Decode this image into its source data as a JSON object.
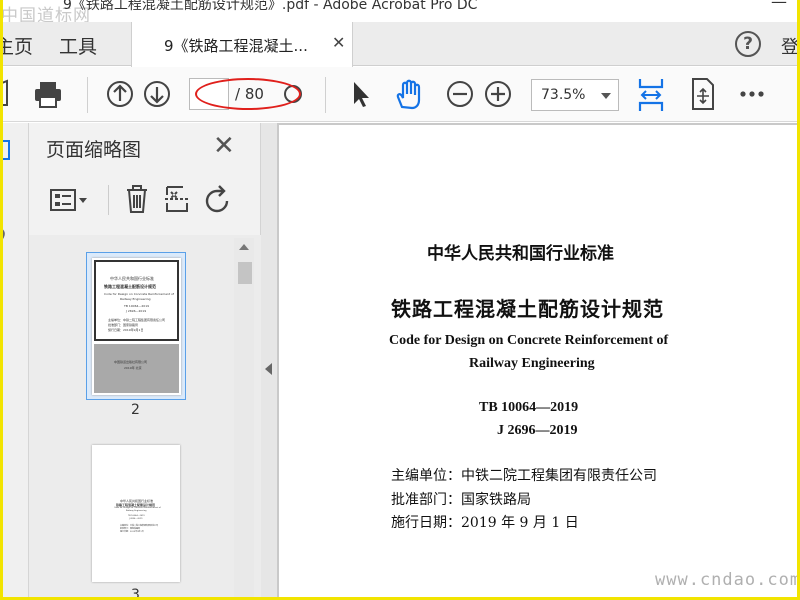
{
  "watermark_top": "中国道标网",
  "title_bar": {
    "title": "9《铁路工程混凝土配筋设计规范》.pdf - Adobe Acrobat Pro DC"
  },
  "menu": {
    "home": "主页",
    "tools": "工具",
    "help_symbol": "?",
    "login": "登"
  },
  "tab": {
    "label": "9《铁路工程混凝土...",
    "close": "✕"
  },
  "toolbar": {
    "page_current": "",
    "page_total": "/ 80",
    "zoom": "73.5%"
  },
  "panel": {
    "title": "页面缩略图",
    "close": "✕"
  },
  "thumbnails": [
    {
      "number": "2",
      "lines": [
        "中华人民共和国行业标准",
        "铁路工程混凝土配筋设计规范",
        "Code for Design on Concrete Reinforcement of",
        "Railway Engineering",
        "TB 10064—2019",
        "J 2696—2019",
        "主编单位：中铁二院工程集团有限责任公司",
        "批准部门：国家铁路局",
        "施行日期：2019年9月1日",
        "中国铁道出版社有限公司",
        "2019年 北京"
      ]
    },
    {
      "number": "3",
      "lines": [
        "中华人民共和国行业标准",
        "铁路工程混凝土配筋设计规范",
        "Code for Design on Concrete Reinforcement of",
        "Railway Engineering",
        "TB 10064—2019",
        "J 2696—2019",
        "主编单位：中铁二院工程集团有限责任公司",
        "批准部门：国家铁路局",
        "施行日期：2019年9月1日"
      ]
    }
  ],
  "document": {
    "line1": "中华人民共和国行业标准",
    "line2": "铁路工程混凝土配筋设计规范",
    "line3": "Code for Design on Concrete Reinforcement of",
    "line4": "Railway Engineering",
    "line5": "TB 10064—2019",
    "line6": "J 2696—2019",
    "line7": "主编单位：中铁二院工程集团有限责任公司",
    "line8": "批准部门：国家铁路局",
    "line9": "施行日期：2019 年 9 月 1 日"
  },
  "watermark_bottom": "www.cndao.com",
  "colors": {
    "accent_blue": "#1473e6",
    "highlight_red": "#e0201c",
    "frame_yellow": "#f2e400"
  }
}
